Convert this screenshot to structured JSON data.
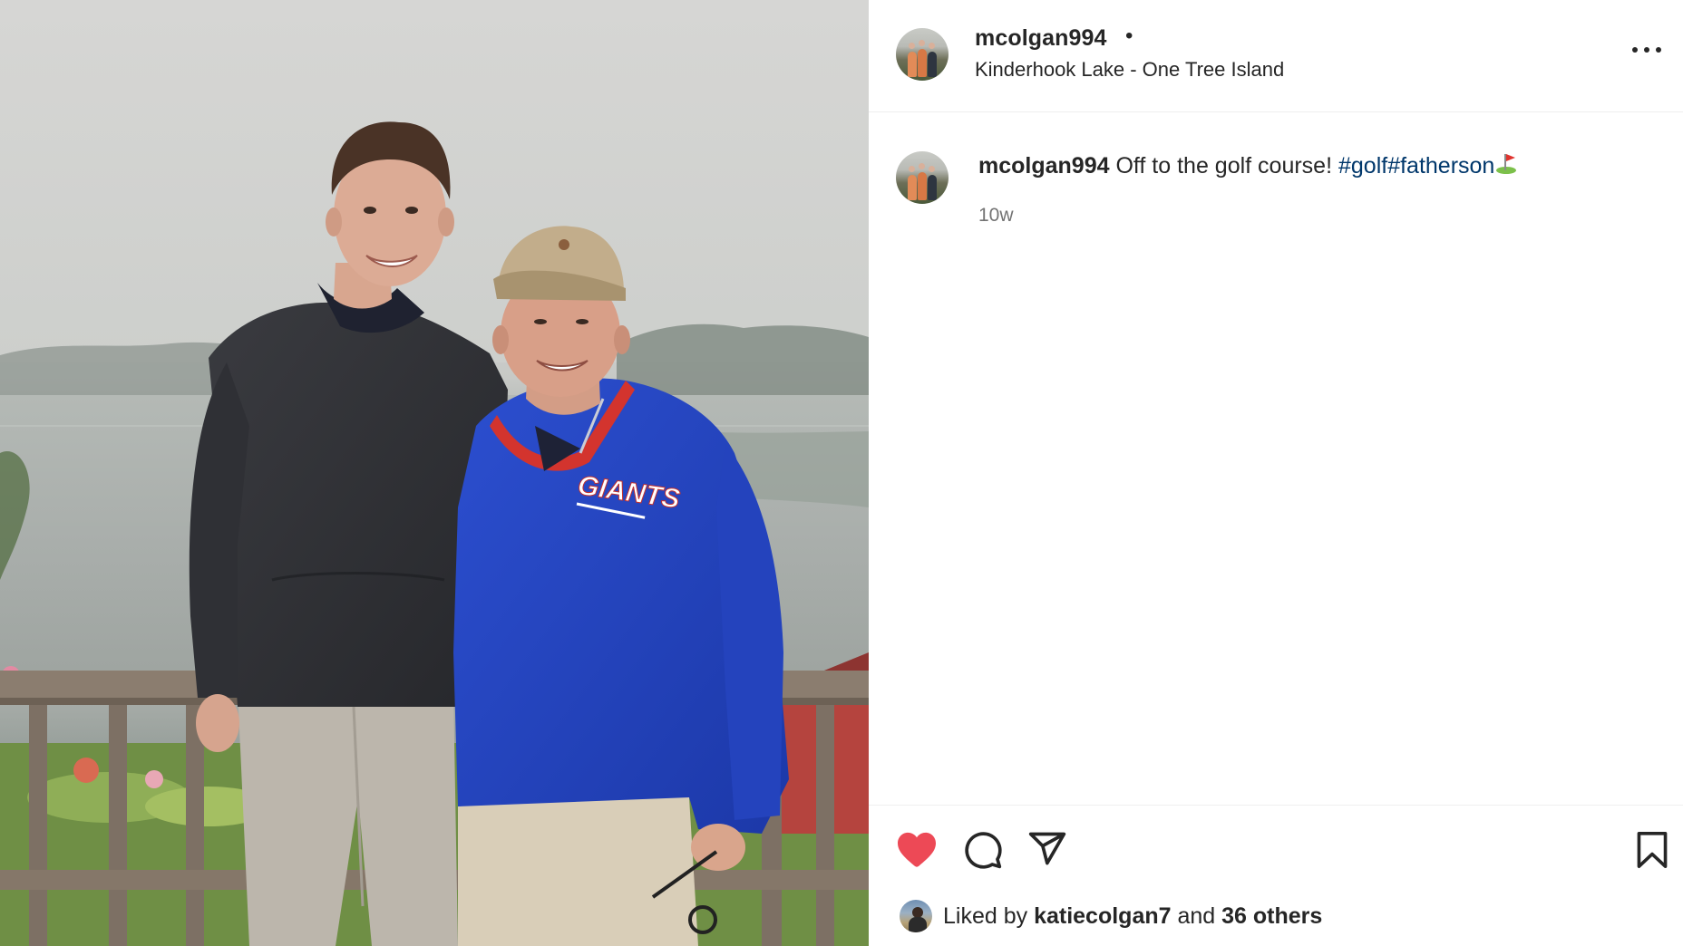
{
  "post": {
    "username": "mcolgan994",
    "separator": "•",
    "location": "Kinderhook Lake - One Tree Island",
    "more_icon": "more-options-icon"
  },
  "caption": {
    "username": "mcolgan994",
    "text": "Off to the golf course!",
    "hashtags": "#golf#fatherson",
    "emoji": "golf-flag-icon",
    "time": "10w"
  },
  "actions": {
    "like_icon": "heart-filled-icon",
    "comment_icon": "comment-icon",
    "share_icon": "share-icon",
    "save_icon": "bookmark-icon",
    "liked": true,
    "colors": {
      "like": "#ed4956",
      "hashtag": "#00376b",
      "text": "#262626",
      "muted": "#737373"
    }
  },
  "likes": {
    "prefix": "Liked by",
    "liker": "katiecolgan7",
    "conjunction": "and",
    "others": "36 others"
  },
  "photo": {
    "shirt_logo": "GIANTS"
  }
}
